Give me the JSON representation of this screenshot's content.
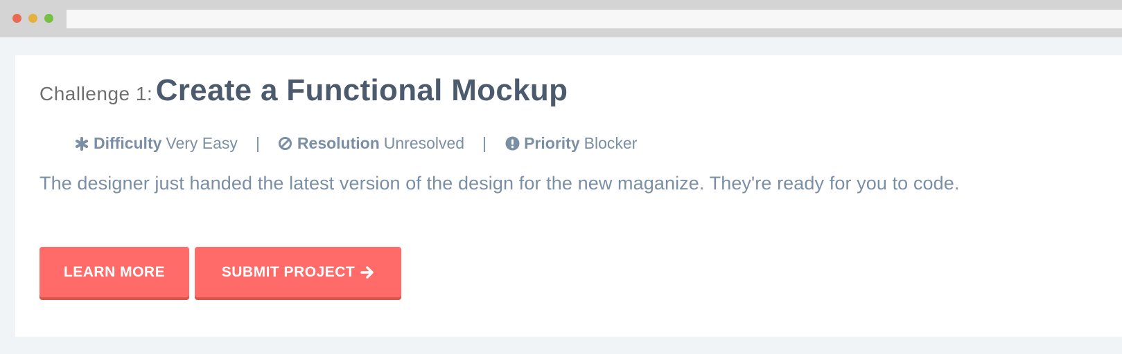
{
  "colors": {
    "dot_red": "#e86a52",
    "dot_yellow": "#e5b03d",
    "dot_green": "#76c043",
    "button": "#ff6b68",
    "title": "#4b5a6d",
    "meta": "#7a8fa6"
  },
  "challenge": {
    "prefix": "Challenge 1:",
    "title": "Create a Functional Mockup",
    "description": "The designer just handed the latest version of the design for the new maganize. They're ready for you to code."
  },
  "meta": {
    "difficulty": {
      "icon": "asterisk-icon",
      "label": "Difficulty",
      "value": "Very Easy"
    },
    "resolution": {
      "icon": "ban-icon",
      "label": "Resolution",
      "value": "Unresolved"
    },
    "priority": {
      "icon": "exclamation-circle-icon",
      "label": "Priority",
      "value": "Blocker"
    },
    "separator": "|"
  },
  "buttons": {
    "learn_more": "LEARN MORE",
    "submit_project": "SUBMIT PROJECT",
    "submit_icon": "arrow-right-icon"
  }
}
